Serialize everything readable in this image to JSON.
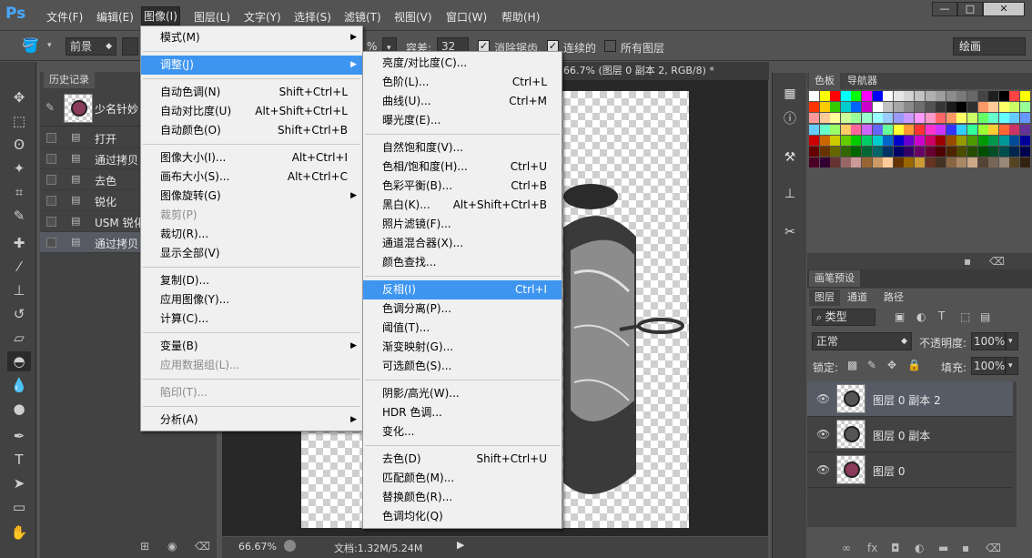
{
  "app": {
    "logo": "Ps"
  },
  "menubar": {
    "items": [
      "文件(F)",
      "编辑(E)",
      "图像(I)",
      "图层(L)",
      "文字(Y)",
      "选择(S)",
      "滤镜(T)",
      "视图(V)",
      "窗口(W)",
      "帮助(H)"
    ],
    "active": "图像(I)"
  },
  "window_controls": {
    "minimize": "—",
    "maximize": "□",
    "close": "✕"
  },
  "options": {
    "fill_source": "前景",
    "opacity_suffix": "%",
    "tolerance_label": "容差:",
    "tolerance_value": "32",
    "antialias_label": "消除锯齿",
    "antialias_checked": true,
    "contiguous_label": "连续的",
    "contiguous_checked": true,
    "all_layers_label": "所有图层",
    "all_layers_checked": false,
    "workspace": "绘画"
  },
  "history": {
    "tab": "历史记录",
    "snapshot_label": "少名针妙",
    "items": [
      {
        "label": "打开",
        "selected": false
      },
      {
        "label": "通过拷贝",
        "selected": false
      },
      {
        "label": "去色",
        "selected": false
      },
      {
        "label": "锐化",
        "selected": false
      },
      {
        "label": "USM 锐化",
        "selected": false
      },
      {
        "label": "通过拷贝",
        "selected": true
      }
    ]
  },
  "document": {
    "tab_title": "66.7% (图层 0 副本 2, RGB/8) *",
    "zoom": "66.67%",
    "doc_info": "文档:1.32M/5.24M"
  },
  "image_menu": {
    "items": [
      {
        "label": "模式(M)",
        "submenu": true
      },
      {
        "sep": true
      },
      {
        "label": "调整(J)",
        "submenu": true,
        "highlight": true
      },
      {
        "sep": true
      },
      {
        "label": "自动色调(N)",
        "shortcut": "Shift+Ctrl+L"
      },
      {
        "label": "自动对比度(U)",
        "shortcut": "Alt+Shift+Ctrl+L"
      },
      {
        "label": "自动颜色(O)",
        "shortcut": "Shift+Ctrl+B"
      },
      {
        "sep": true
      },
      {
        "label": "图像大小(I)...",
        "shortcut": "Alt+Ctrl+I"
      },
      {
        "label": "画布大小(S)...",
        "shortcut": "Alt+Ctrl+C"
      },
      {
        "label": "图像旋转(G)",
        "submenu": true
      },
      {
        "label": "裁剪(P)",
        "disabled": true
      },
      {
        "label": "裁切(R)..."
      },
      {
        "label": "显示全部(V)"
      },
      {
        "sep": true
      },
      {
        "label": "复制(D)..."
      },
      {
        "label": "应用图像(Y)..."
      },
      {
        "label": "计算(C)..."
      },
      {
        "sep": true
      },
      {
        "label": "变量(B)",
        "submenu": true
      },
      {
        "label": "应用数据组(L)...",
        "disabled": true
      },
      {
        "sep": true
      },
      {
        "label": "陷印(T)...",
        "disabled": true
      },
      {
        "sep": true
      },
      {
        "label": "分析(A)",
        "submenu": true
      }
    ]
  },
  "adjust_menu": {
    "items": [
      {
        "label": "亮度/对比度(C)..."
      },
      {
        "label": "色阶(L)...",
        "shortcut": "Ctrl+L"
      },
      {
        "label": "曲线(U)...",
        "shortcut": "Ctrl+M"
      },
      {
        "label": "曝光度(E)..."
      },
      {
        "sep": true
      },
      {
        "label": "自然饱和度(V)..."
      },
      {
        "label": "色相/饱和度(H)...",
        "shortcut": "Ctrl+U"
      },
      {
        "label": "色彩平衡(B)...",
        "shortcut": "Ctrl+B"
      },
      {
        "label": "黑白(K)...",
        "shortcut": "Alt+Shift+Ctrl+B"
      },
      {
        "label": "照片滤镜(F)..."
      },
      {
        "label": "通道混合器(X)..."
      },
      {
        "label": "颜色查找..."
      },
      {
        "sep": true
      },
      {
        "label": "反相(I)",
        "shortcut": "Ctrl+I",
        "highlight": true
      },
      {
        "label": "色调分离(P)..."
      },
      {
        "label": "阈值(T)..."
      },
      {
        "label": "渐变映射(G)..."
      },
      {
        "label": "可选颜色(S)..."
      },
      {
        "sep": true
      },
      {
        "label": "阴影/高光(W)..."
      },
      {
        "label": "HDR 色调..."
      },
      {
        "label": "变化..."
      },
      {
        "sep": true
      },
      {
        "label": "去色(D)",
        "shortcut": "Shift+Ctrl+U"
      },
      {
        "label": "匹配颜色(M)..."
      },
      {
        "label": "替换颜色(R)..."
      },
      {
        "label": "色调均化(Q)"
      }
    ]
  },
  "swatches_panel": {
    "tabs": [
      "色板",
      "导航器"
    ],
    "active": "色板"
  },
  "brush_panel": {
    "tab": "画笔预设"
  },
  "layers_panel": {
    "tabs": [
      "图层",
      "通道",
      "路径"
    ],
    "active": "图层",
    "filter_kind": "类型",
    "blend_mode": "正常",
    "opacity_label": "不透明度:",
    "opacity_value": "100%",
    "lock_label": "锁定:",
    "fill_label": "填充:",
    "fill_value": "100%",
    "layers": [
      {
        "name": "图层 0 副本 2",
        "selected": true,
        "colored": false
      },
      {
        "name": "图层 0 副本",
        "selected": false,
        "colored": false
      },
      {
        "name": "图层 0",
        "selected": false,
        "colored": true
      }
    ]
  },
  "colors": {
    "menu_highlight": "#3d95f0",
    "ps_blue": "#49a8ff"
  }
}
